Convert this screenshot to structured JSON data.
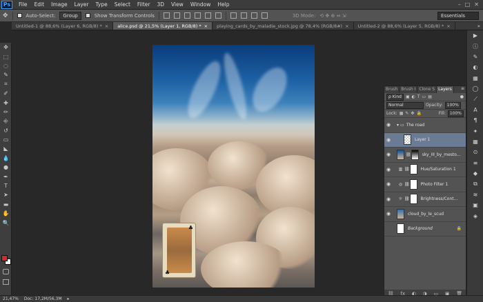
{
  "menubar": {
    "logo": "Ps",
    "items": [
      "File",
      "Edit",
      "Image",
      "Layer",
      "Type",
      "Select",
      "Filter",
      "3D",
      "View",
      "Window",
      "Help"
    ],
    "window_controls": [
      "–",
      "□",
      "✕"
    ]
  },
  "options": {
    "auto_select_label": "Auto-Select:",
    "auto_select_value": "Group",
    "show_transform_label": "Show Transform Controls",
    "mode_3d_label": "3D Mode:",
    "workspace": "Essentials"
  },
  "tabs": [
    {
      "label": "Untitled-1 @ 88,6% (Layer 6, RGB/8) *",
      "active": false
    },
    {
      "label": "alice.psd @ 21,5% (Layer 1, RGB/8) *",
      "active": true
    },
    {
      "label": "playing_cards_by_maladie_stock.jpg @ 78,4% (RGB/8#)",
      "active": false
    },
    {
      "label": "Untitled-2 @ 88,6% (Layer 5, RGB/8) *",
      "active": false
    }
  ],
  "tools": [
    "move-icon",
    "marquee-icon",
    "lasso-icon",
    "quick-select-icon",
    "crop-icon",
    "eyedropper-icon",
    "healing-icon",
    "brush-icon",
    "clone-stamp-icon",
    "history-brush-icon",
    "eraser-icon",
    "paint-bucket-icon",
    "blur-icon",
    "dodge-icon",
    "pen-icon",
    "type-icon",
    "path-select-icon",
    "shape-icon",
    "hand-icon",
    "zoom-icon"
  ],
  "tool_glyphs": [
    "✥",
    "⬚",
    "◌",
    "✎",
    "⌗",
    "✐",
    "✚",
    "✏",
    "⎆",
    "↺",
    "▭",
    "◣",
    "💧",
    "●",
    "✒",
    "T",
    "➤",
    "▬",
    "✋",
    "🔍"
  ],
  "colors": {
    "foreground": "#d42a26",
    "background": "#ffffff",
    "accent": "#6c7b94"
  },
  "right_strip_glyphs": [
    "▶",
    "ⓘ",
    "✎",
    "◐",
    "▦",
    "◯",
    "⟋",
    "A",
    "¶",
    "✦",
    "▦",
    "⊙",
    "≡",
    "◆",
    "⧉",
    "≋",
    "▣",
    "◈"
  ],
  "layers_panel": {
    "tabs": [
      {
        "label": "Brush",
        "active": false
      },
      {
        "label": "Brush I",
        "active": false
      },
      {
        "label": "Clone S",
        "active": false
      },
      {
        "label": "Layers",
        "active": true
      }
    ],
    "kind_label": "ρ Kind",
    "blend_mode": "Normal",
    "opacity_label": "Opacity:",
    "opacity_value": "100%",
    "lock_label": "Lock:",
    "fill_label": "Fill:",
    "fill_value": "100%",
    "layers": [
      {
        "name": "The road",
        "type": "group",
        "selected": false
      },
      {
        "name": "Layer 1",
        "type": "pixel",
        "selected": true
      },
      {
        "name": "sky_III_by_mesto...",
        "type": "masked",
        "selected": false
      },
      {
        "name": "Hue/Saturation 1",
        "type": "adjustment",
        "selected": false
      },
      {
        "name": "Photo Filter 1",
        "type": "adjustment",
        "selected": false
      },
      {
        "name": "Brightness/Cont...",
        "type": "adjustment",
        "selected": false
      },
      {
        "name": "cloud_by_le_scud",
        "type": "pixel",
        "selected": false
      },
      {
        "name": "Background",
        "type": "background",
        "selected": false
      }
    ],
    "bottom_icons": [
      "⛓",
      "fx",
      "◐",
      "◑",
      "▭",
      "▣",
      "🗑"
    ]
  },
  "status": {
    "zoom": "21,47%",
    "doc": "Doc: 17,2M/56,3M"
  }
}
